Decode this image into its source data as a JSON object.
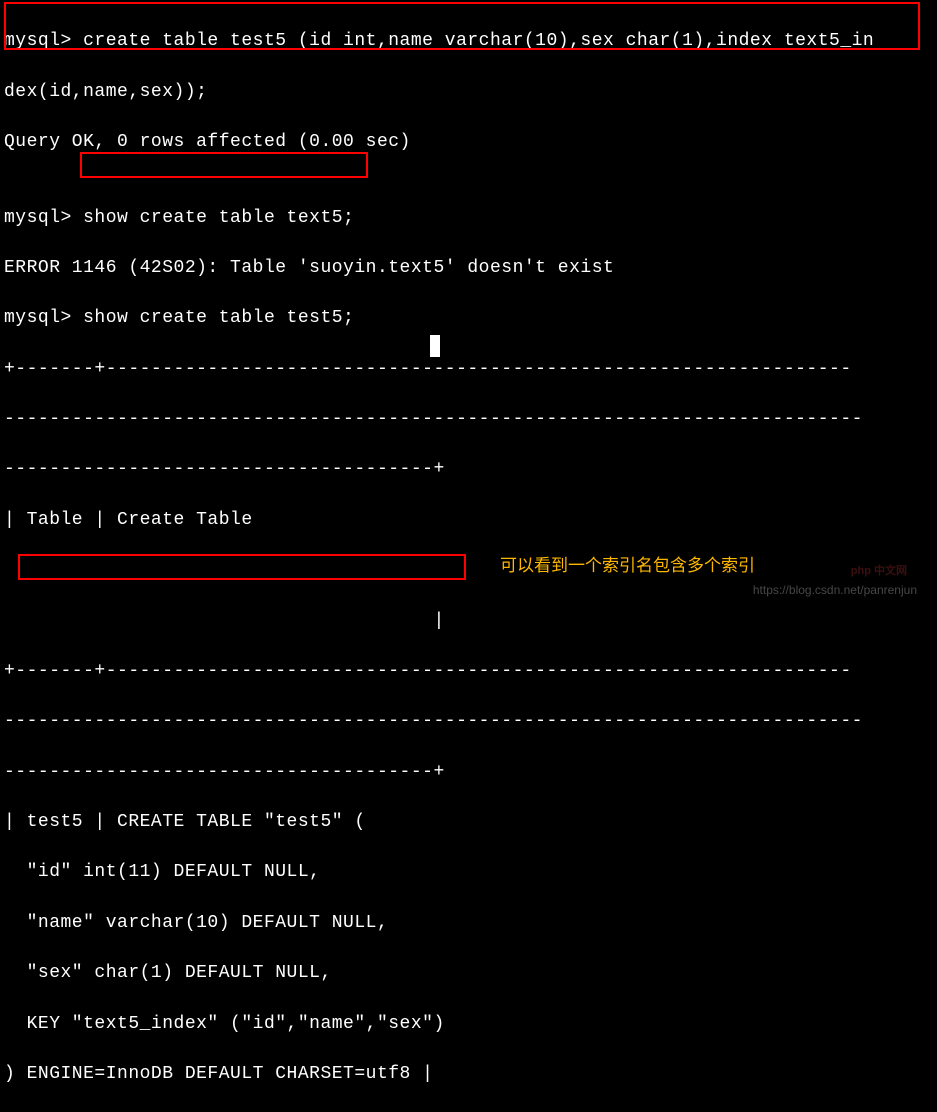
{
  "terminal": {
    "line1": "mysql> create table test5 (id int,name varchar(10),sex char(1),index text5_in",
    "line2": "dex(id,name,sex));",
    "line3": "Query OK, 0 rows affected (0.00 sec)",
    "line4": "",
    "line5": "mysql> show create table text5;",
    "line6": "ERROR 1146 (42S02): Table 'suoyin.text5' doesn't exist",
    "line7": "mysql> show create table test5;",
    "line8": "+-------+------------------------------------------------------------------",
    "line9": "----------------------------------------------------------------------------",
    "line10": "--------------------------------------+",
    "line11": "| Table | Create Table                                                      ",
    "line12": "                                                                            ",
    "line13": "                                      |",
    "line14": "+-------+------------------------------------------------------------------",
    "line15": "----------------------------------------------------------------------------",
    "line16": "--------------------------------------+",
    "line17": "| test5 | CREATE TABLE \"test5\" (",
    "line18": "  \"id\" int(11) DEFAULT NULL,",
    "line19": "  \"name\" varchar(10) DEFAULT NULL,",
    "line20": "  \"sex\" char(1) DEFAULT NULL,",
    "line21": "  KEY \"text5_index\" (\"id\",\"name\",\"sex\")",
    "line22": ") ENGINE=InnoDB DEFAULT CHARSET=utf8 |"
  },
  "annotation": "可以看到一个索引名包含多个索引",
  "watermark": "https://blog.csdn.net/panrenjun",
  "phplogo": "php 中文网"
}
